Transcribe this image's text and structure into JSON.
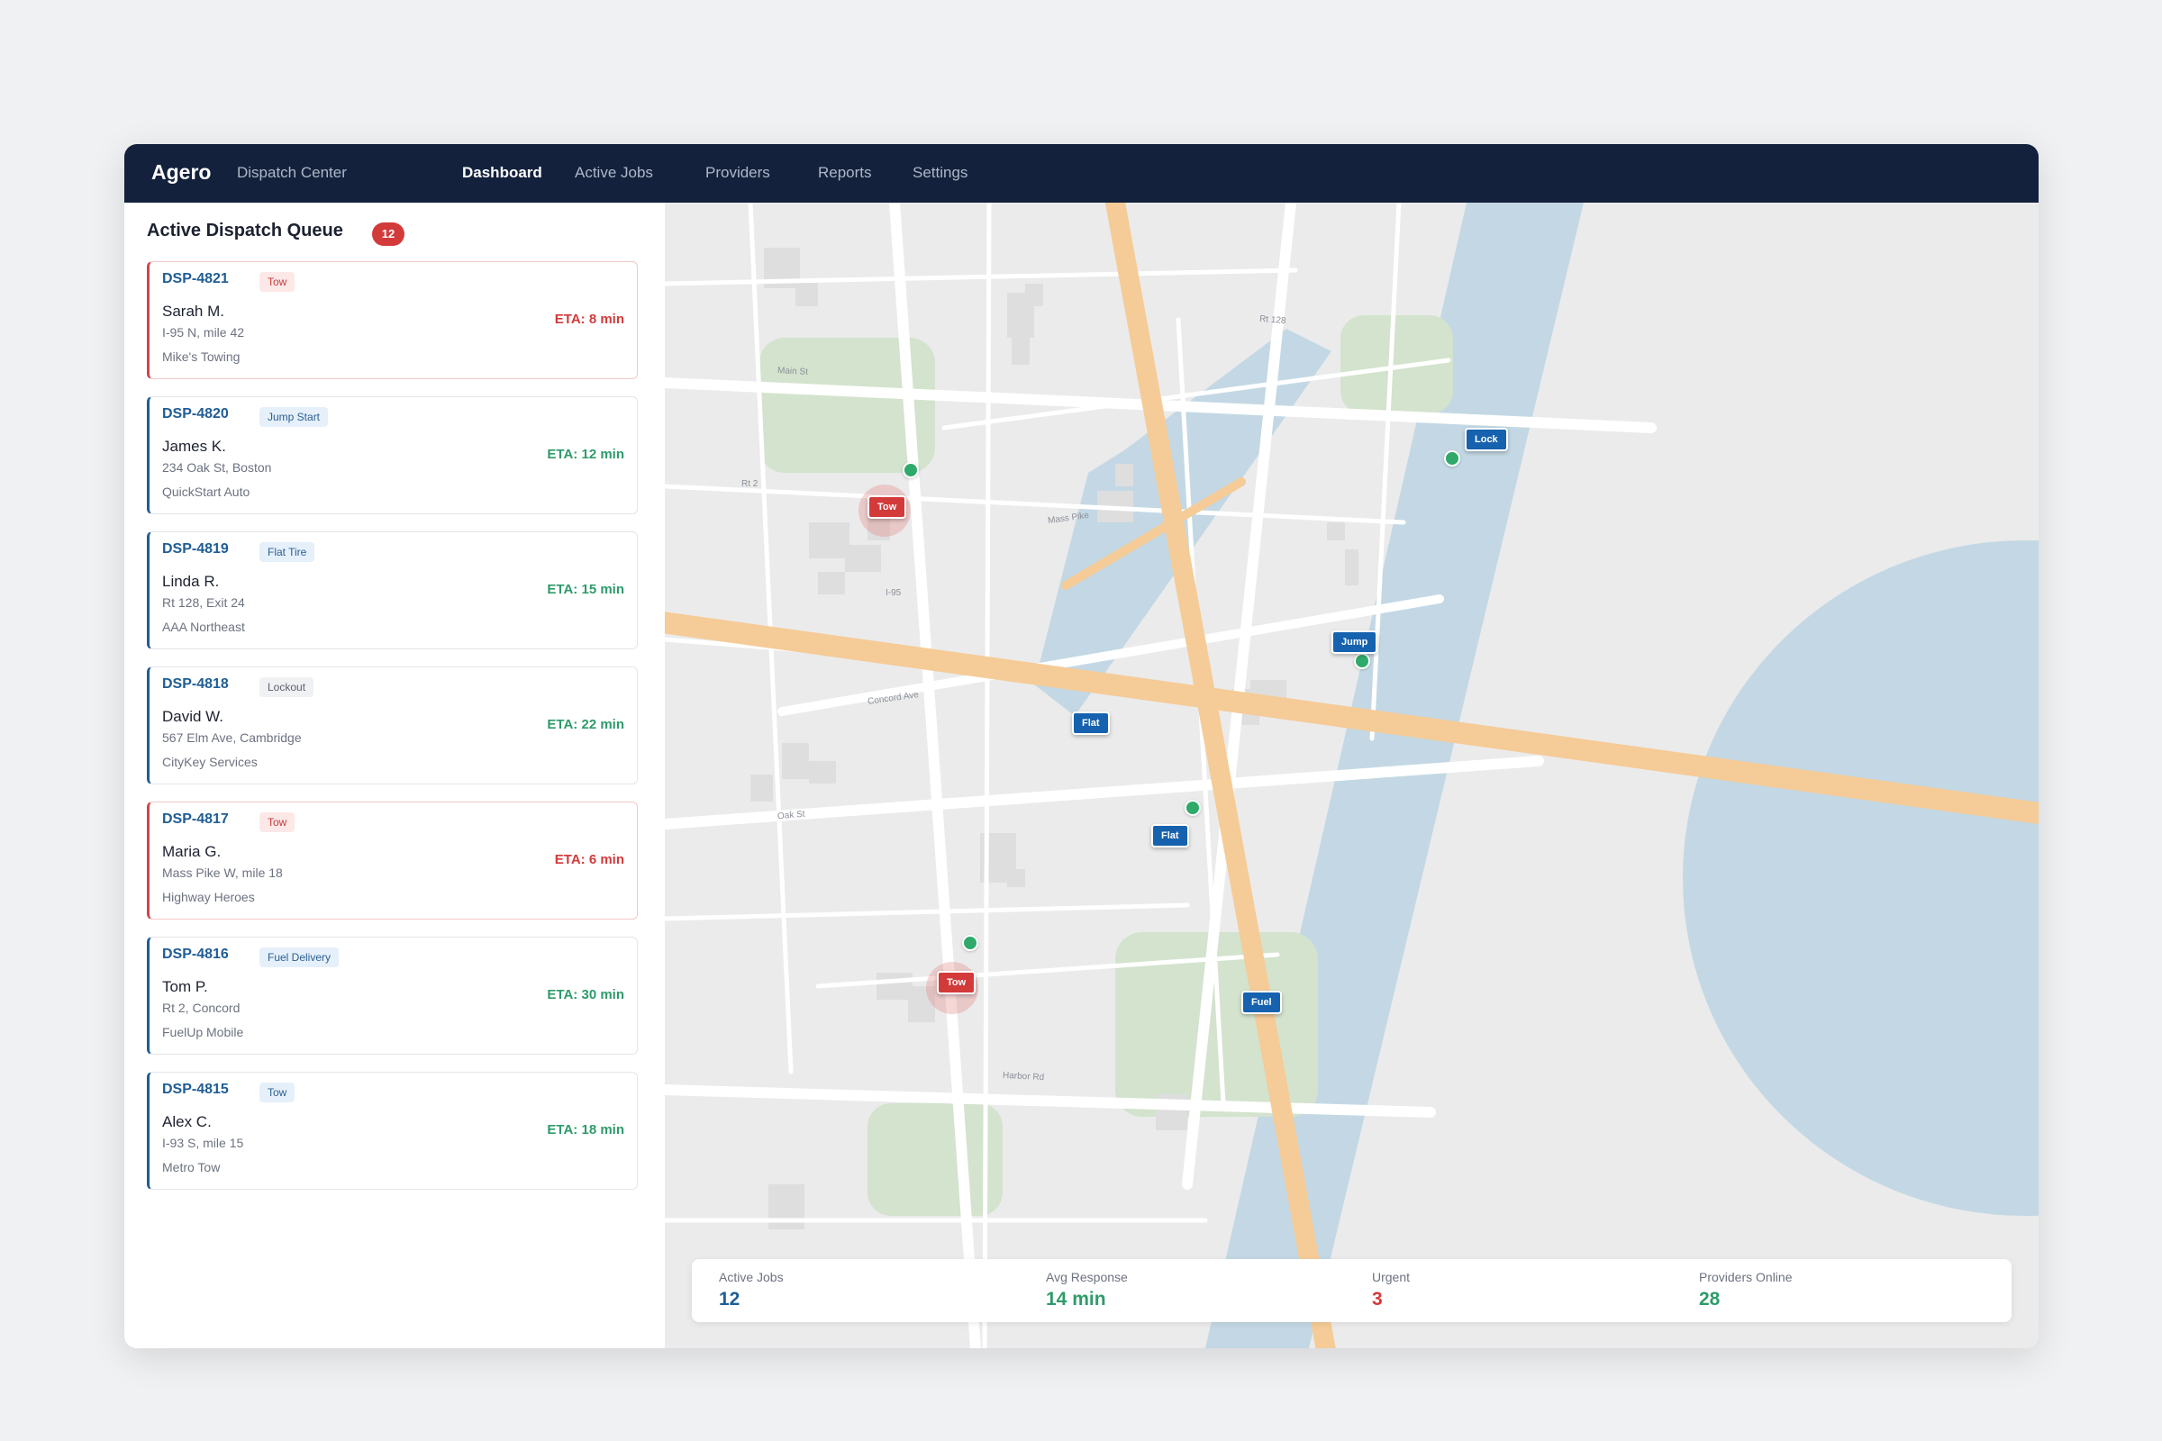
{
  "app": {
    "brand": "Agero",
    "subtitle": "Dispatch Center"
  },
  "nav": {
    "items": [
      {
        "label": "Dashboard",
        "active": true
      },
      {
        "label": "Active Jobs",
        "active": false
      },
      {
        "label": "Providers",
        "active": false
      },
      {
        "label": "Reports",
        "active": false
      },
      {
        "label": "Settings",
        "active": false
      }
    ]
  },
  "queue": {
    "title": "Active Dispatch Queue",
    "count": "12",
    "cards": [
      {
        "id": "DSP-4821",
        "type": "Tow",
        "type_color": "red",
        "customer": "Sarah M.",
        "location": "I-95 N, mile 42",
        "provider": "Mike's Towing",
        "eta": "ETA: 8 min",
        "eta_color": "red",
        "urgent": true
      },
      {
        "id": "DSP-4820",
        "type": "Jump Start",
        "type_color": "blue",
        "customer": "James K.",
        "location": "234 Oak St, Boston",
        "provider": "QuickStart Auto",
        "eta": "ETA: 12 min",
        "eta_color": "green",
        "urgent": false
      },
      {
        "id": "DSP-4819",
        "type": "Flat Tire",
        "type_color": "blue",
        "customer": "Linda R.",
        "location": "Rt 128, Exit 24",
        "provider": "AAA Northeast",
        "eta": "ETA: 15 min",
        "eta_color": "green",
        "urgent": false
      },
      {
        "id": "DSP-4818",
        "type": "Lockout",
        "type_color": "gray",
        "customer": "David W.",
        "location": "567 Elm Ave, Cambridge",
        "provider": "CityKey Services",
        "eta": "ETA: 22 min",
        "eta_color": "green",
        "urgent": false
      },
      {
        "id": "DSP-4817",
        "type": "Tow",
        "type_color": "red",
        "customer": "Maria G.",
        "location": "Mass Pike W, mile 18",
        "provider": "Highway Heroes",
        "eta": "ETA: 6 min",
        "eta_color": "red",
        "urgent": true
      },
      {
        "id": "DSP-4816",
        "type": "Fuel Delivery",
        "type_color": "blue",
        "customer": "Tom P.",
        "location": "Rt 2, Concord",
        "provider": "FuelUp Mobile",
        "eta": "ETA: 30 min",
        "eta_color": "green",
        "urgent": false
      },
      {
        "id": "DSP-4815",
        "type": "Tow",
        "type_color": "blue",
        "customer": "Alex C.",
        "location": "I-93 S, mile 15",
        "provider": "Metro Tow",
        "eta": "ETA: 18 min",
        "eta_color": "green",
        "urgent": false
      }
    ]
  },
  "map": {
    "streets": [
      "Rt 128",
      "Main St",
      "Rt 2",
      "Mass Pike",
      "I-95",
      "Concord Ave",
      "Oak St",
      "Harbor Rd"
    ],
    "markers": [
      {
        "label": "Lock",
        "color": "blue"
      },
      {
        "label": "Tow",
        "color": "red"
      },
      {
        "label": "Jump",
        "color": "blue"
      },
      {
        "label": "Flat",
        "color": "blue"
      },
      {
        "label": "Flat",
        "color": "blue"
      },
      {
        "label": "Tow",
        "color": "red"
      },
      {
        "label": "Fuel",
        "color": "blue"
      }
    ]
  },
  "stats": [
    {
      "label": "Active Jobs",
      "value": "12",
      "color": "#1f5d96"
    },
    {
      "label": "Avg Response",
      "value": "14 min",
      "color": "#2e9b6a"
    },
    {
      "label": "Urgent",
      "value": "3",
      "color": "#d33a3a"
    },
    {
      "label": "Providers Online",
      "value": "28",
      "color": "#2e9b6a"
    }
  ],
  "colors": {
    "topbar": "#13213c",
    "accent": "#1f5d96",
    "urgent": "#d33a3a",
    "success": "#2e9b6a",
    "water": "#c3d8e4",
    "park": "#d3e3cd",
    "highway": "#f5cb97"
  }
}
